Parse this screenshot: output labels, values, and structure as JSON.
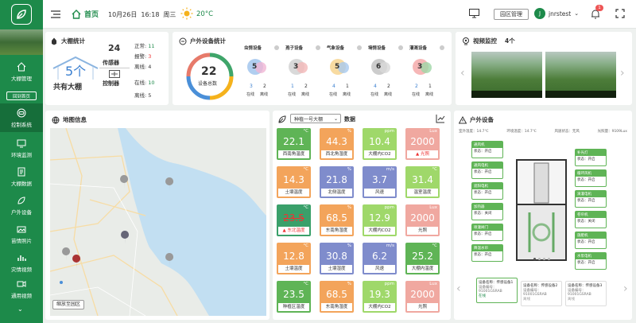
{
  "sidebar": {
    "items": [
      {
        "label": "大棚管理",
        "icon": "home-icon"
      },
      {
        "label": "控制系统",
        "icon": "control-icon"
      },
      {
        "label": "环境监测",
        "icon": "monitor-icon"
      },
      {
        "label": "大棚数据",
        "icon": "data-icon"
      },
      {
        "label": "户外设备",
        "icon": "device-icon"
      },
      {
        "label": "苗情照片",
        "icon": "photo-icon"
      },
      {
        "label": "灾情视频",
        "icon": "disaster-icon"
      },
      {
        "label": "通用视频",
        "icon": "video-icon"
      }
    ],
    "tag": "回到首页"
  },
  "topbar": {
    "home": "首页",
    "date": "10月26日",
    "time": "16:18",
    "weekday": "周三",
    "temp": "20°C",
    "manage_btn": "园区管理",
    "user_initial": "J",
    "username": "jnrstest",
    "badge": "1"
  },
  "greenhouse": {
    "title": "大棚统计",
    "count_value": "5个",
    "count_label": "共有大棚",
    "sensor_count": "24",
    "sensor_label": "传感器",
    "controller_label": "控制器",
    "normal_label": "正常:",
    "normal_value": "11",
    "alarm_label": "报警:",
    "alarm_value": "3",
    "offline_label": "离线:",
    "offline_value": "4",
    "online_label": "在线:",
    "online_value": "10",
    "offline2_label": "离线:",
    "offline2_value": "5"
  },
  "outdoor": {
    "title": "户外设备统计",
    "total": "22",
    "total_label": "设备总数",
    "online_label": "在线",
    "offline_label": "离线",
    "groups": [
      {
        "name": "虫情设备",
        "count": "5",
        "online": "3",
        "offline": "2"
      },
      {
        "name": "孢子设备",
        "count": "3",
        "online": "1",
        "offline": "2"
      },
      {
        "name": "气象设备",
        "count": "5",
        "online": "4",
        "offline": "1"
      },
      {
        "name": "墒情设备",
        "count": "6",
        "online": "4",
        "offline": "2"
      },
      {
        "name": "灌溉设备",
        "count": "3",
        "online": "2",
        "offline": "1"
      }
    ]
  },
  "video": {
    "title": "视频监控",
    "count": "4个"
  },
  "map": {
    "title": "地图信息",
    "btn": "缩放至园区"
  },
  "data_panel": {
    "select": "种植一号大棚",
    "title": "数据",
    "cells": [
      {
        "value": "22.1",
        "unit": "°C",
        "label": "西南角温度",
        "color": "g"
      },
      {
        "value": "44.3",
        "unit": "%",
        "label": "西北角湿度",
        "color": "o"
      },
      {
        "value": "10.4",
        "unit": "ppm",
        "label": "大棚内CO2",
        "color": "lg"
      },
      {
        "value": "2000",
        "unit": "Lux",
        "label": "光照",
        "color": "p",
        "warn": true
      },
      {
        "value": "14.3",
        "unit": "°C",
        "label": "土壤温度",
        "color": "o"
      },
      {
        "value": "21.8",
        "unit": "%",
        "label": "北侧温度",
        "color": "b"
      },
      {
        "value": "3.7",
        "unit": "m/s",
        "label": "风速",
        "color": "b"
      },
      {
        "value": "31.4",
        "unit": "°C",
        "label": "温室温度",
        "color": "lg"
      },
      {
        "value": "23.5",
        "unit": "°C",
        "label": "东北温度",
        "color": "dg",
        "warn": true,
        "strike": true
      },
      {
        "value": "68.5",
        "unit": "%",
        "label": "东南角湿度",
        "color": "o"
      },
      {
        "value": "12.9",
        "unit": "ppm",
        "label": "大棚内CO2",
        "color": "lg"
      },
      {
        "value": "2000",
        "unit": "Lux",
        "label": "光照",
        "color": "p"
      },
      {
        "value": "12.8",
        "unit": "°C",
        "label": "土壤温度",
        "color": "o"
      },
      {
        "value": "30.8",
        "unit": "%",
        "label": "土壤湿度",
        "color": "b"
      },
      {
        "value": "6.2",
        "unit": "m/s",
        "label": "风速",
        "color": "b"
      },
      {
        "value": "25.2",
        "unit": "°C",
        "label": "大棚内温度",
        "color": "g"
      },
      {
        "value": "23.5",
        "unit": "°C",
        "label": "种植区温度",
        "color": "g"
      },
      {
        "value": "68.5",
        "unit": "%",
        "label": "东南角湿度",
        "color": "o"
      },
      {
        "value": "19.3",
        "unit": "ppm",
        "label": "大棚内CO2",
        "color": "lg"
      },
      {
        "value": "2000",
        "unit": "Lux",
        "label": "光照",
        "color": "p"
      }
    ]
  },
  "outdoor_eq": {
    "title": "户外设备",
    "weather": [
      {
        "label": "室外温度：14.7℃"
      },
      {
        "label": "环境温度：14.7℃"
      },
      {
        "label": "风速状态：无风"
      },
      {
        "label": "光照量：9109Lux"
      }
    ],
    "left_boxes": [
      {
        "title": "通风机",
        "status": "状态：开启"
      },
      {
        "title": "通风电机",
        "status": "状态：开启"
      },
      {
        "title": "遮阳电机",
        "status": "状态：开启"
      },
      {
        "title": "加热器",
        "status": "状态：关闭"
      },
      {
        "title": "喷灌阀门",
        "status": "状态：开启"
      },
      {
        "title": "降温水帘",
        "status": "状态：开启"
      }
    ],
    "right_boxes": [
      {
        "title": "补光灯",
        "status": "状态：开启"
      },
      {
        "title": "循环风机",
        "status": "状态：开启"
      },
      {
        "title": "滴灌电机",
        "status": "状态：开启"
      },
      {
        "title": "卷帘机",
        "status": "状态：关闭"
      },
      {
        "title": "施肥机",
        "status": "状态：开启"
      },
      {
        "title": "水泵电机",
        "status": "状态：开启"
      }
    ],
    "cards": [
      {
        "title": "设备名称：传感设备1",
        "sub": "设备编号：91001GSRAB",
        "status": "在线"
      },
      {
        "title": "设备名称：传感设备2",
        "sub": "设备编号：91001GSRAB",
        "status": "离线"
      },
      {
        "title": "设备名称：传感设备3",
        "sub": "设备编号：91001GSRAB",
        "status": "离线"
      }
    ]
  },
  "colors": {
    "primary": "#1d8a4a",
    "accent": "#5fb456",
    "warn": "#e33333"
  }
}
